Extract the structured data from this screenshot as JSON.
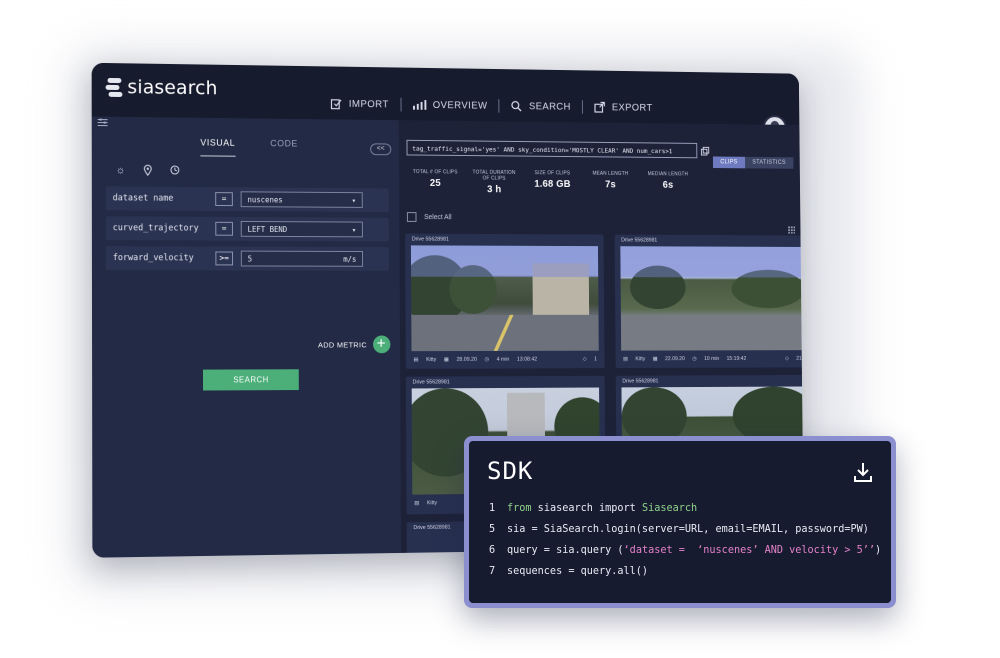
{
  "app": {
    "brand": "siasearch"
  },
  "nav": {
    "items": [
      {
        "label": "IMPORT"
      },
      {
        "label": "OVERVIEW"
      },
      {
        "label": "SEARCH"
      },
      {
        "label": "EXPORT"
      }
    ],
    "active": "SEARCH"
  },
  "left_panel": {
    "tabs": [
      "VISUAL",
      "CODE"
    ],
    "collapse_label": "<<",
    "filters": [
      {
        "name": "dataset name",
        "op": "=",
        "value": "nuscenes",
        "unit": "▾"
      },
      {
        "name": "curved_trajectory",
        "op": "=",
        "value": "LEFT BEND",
        "unit": "▾"
      },
      {
        "name": "forward_velocity",
        "op": ">=",
        "value": "5",
        "unit": "m/s"
      }
    ],
    "add_metric_label": "ADD METRIC",
    "search_label": "SEARCH"
  },
  "results": {
    "query": "tag_traffic_signal='yes' AND sky_condition='MOSTLY CLEAR' AND num_cars>1",
    "view_toggle": [
      "CLIPS",
      "STATISTICS"
    ],
    "stats": [
      {
        "label": "TOTAL # OF CLIPS",
        "value": "25"
      },
      {
        "label": "TOTAL DURATION OF CLIPS",
        "value": "3 h"
      },
      {
        "label": "SIZE OF CLIPS",
        "value": "1.68 GB"
      },
      {
        "label": "MEAN LENGTH",
        "value": "7s"
      },
      {
        "label": "MEDIAN LENGTH",
        "value": "6s"
      }
    ],
    "select_all_label": "Select All",
    "cards": [
      {
        "drive": "Drive 55628981",
        "dataset": "Kitty",
        "date": "28.09.20",
        "duration": "4 min",
        "time": "13:08:42",
        "tags": "1"
      },
      {
        "drive": "Drive 55628981",
        "dataset": "Kitty",
        "date": "22.09.20",
        "duration": "10 min",
        "time": "15:19:42",
        "tags": "21"
      },
      {
        "drive": "Drive 55628981",
        "dataset": "Kitty"
      },
      {
        "drive": "Drive 55628981"
      },
      {
        "drive": "Drive 55628981"
      }
    ]
  },
  "sdk": {
    "title": "SDK",
    "lines": [
      {
        "num": "1",
        "kw": "from",
        "text1": " siasearch import ",
        "cls": "Siasearch"
      },
      {
        "num": "5",
        "text": "sia = SiaSearch.login(server=URL, email=EMAIL, password=PW)"
      },
      {
        "num": "6",
        "pre": "query = sia.query (",
        "str": "‘dataset =  ‘nuscenes’ AND velocity > 5’’",
        "post": ")"
      },
      {
        "num": "7",
        "text": "sequences = query.all()"
      }
    ]
  },
  "colors": {
    "accent_green": "#4caf7a",
    "sdk_border": "#8b8fd0",
    "keyword": "#8ed28a",
    "string": "#e482c8"
  },
  "icons": [
    "sliders-icon",
    "sun-icon",
    "location-pin-icon",
    "clock-icon",
    "import-icon",
    "chart-bars-icon",
    "search-icon",
    "export-icon",
    "download-icon",
    "copy-icon",
    "grid-icon",
    "database-icon",
    "calendar-icon",
    "clock-small-icon",
    "tag-icon"
  ]
}
